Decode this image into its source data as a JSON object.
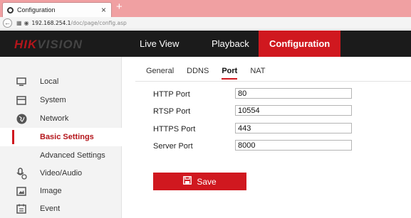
{
  "browser": {
    "tab_title": "Configuration",
    "tab_close": "×",
    "new_tab": "+",
    "url_host": "192.168.254.1",
    "url_path": "/doc/page/config.asp"
  },
  "header": {
    "logo_red": "HIK",
    "logo_rest": "VISION",
    "nav": [
      "Live View",
      "Playback",
      "Configuration"
    ],
    "active_nav": "Configuration"
  },
  "sidebar": {
    "items": [
      {
        "label": "Local",
        "icon": "monitor-icon"
      },
      {
        "label": "System",
        "icon": "system-icon"
      },
      {
        "label": "Network",
        "icon": "globe-icon"
      },
      {
        "label": "Basic Settings",
        "icon": ""
      },
      {
        "label": "Advanced Settings",
        "icon": ""
      },
      {
        "label": "Video/Audio",
        "icon": "camera-icon"
      },
      {
        "label": "Image",
        "icon": "image-icon"
      },
      {
        "label": "Event",
        "icon": "calendar-icon"
      }
    ],
    "active_item": "Basic Settings"
  },
  "subtabs": {
    "items": [
      "General",
      "DDNS",
      "Port",
      "NAT"
    ],
    "active": "Port"
  },
  "form": {
    "http_label": "HTTP Port",
    "http_value": "80",
    "rtsp_label": "RTSP Port",
    "rtsp_value": "10554",
    "https_label": "HTTPS Port",
    "https_value": "443",
    "server_label": "Server Port",
    "server_value": "8000"
  },
  "actions": {
    "save_label": "Save"
  },
  "colors": {
    "accent": "#d0181f",
    "nav_bg": "#1b1b1b",
    "tabbar_bg": "#f0a0a2"
  }
}
